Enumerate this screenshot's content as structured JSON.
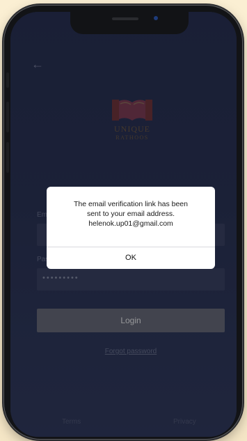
{
  "header": {
    "back_icon": "arrow-left-icon"
  },
  "logo": {
    "brand_line1": "UNIQUE",
    "brand_line2": "RATHOOS"
  },
  "form": {
    "email_label": "Email",
    "password_label": "Password",
    "password_value": "•••••••••",
    "login_label": "Login",
    "forgot_label": "Forgot password"
  },
  "footer": {
    "terms_label": "Terms",
    "privacy_label": "Privacy"
  },
  "dialog": {
    "message_lines": [
      "The email verification link has been",
      "sent to your email address.",
      "helenok.up01@gmail.com"
    ],
    "ok_label": "OK"
  },
  "colors": {
    "background": "#f9eccf",
    "screen": "#2d365a",
    "login_button": "#6b6f7e",
    "dialog": "#ffffff"
  }
}
